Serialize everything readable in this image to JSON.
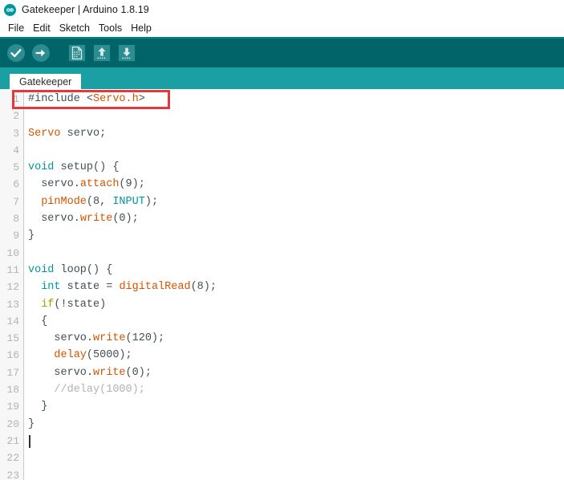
{
  "window": {
    "title": "Gatekeeper | Arduino 1.8.19",
    "logo_icon": "arduino-infinity-icon"
  },
  "menubar": {
    "items": [
      {
        "label": "File"
      },
      {
        "label": "Edit"
      },
      {
        "label": "Sketch"
      },
      {
        "label": "Tools"
      },
      {
        "label": "Help"
      }
    ]
  },
  "toolbar": {
    "background": "#006468",
    "buttons": [
      {
        "name": "verify-button",
        "icon": "check-circle-icon",
        "tooltip": "Verify"
      },
      {
        "name": "upload-button",
        "icon": "arrow-right-circle-icon",
        "tooltip": "Upload"
      },
      {
        "name": "new-button",
        "icon": "new-file-icon",
        "tooltip": "New"
      },
      {
        "name": "open-button",
        "icon": "arrow-up-open-icon",
        "tooltip": "Open"
      },
      {
        "name": "save-button",
        "icon": "arrow-down-save-icon",
        "tooltip": "Save"
      }
    ]
  },
  "tabbar": {
    "background": "#1a9fa2",
    "tabs": [
      {
        "label": "Gatekeeper",
        "active": true
      }
    ]
  },
  "editor": {
    "gutter_numbers": [
      "1",
      "2",
      "3",
      "4",
      "5",
      "6",
      "7",
      "8",
      "9",
      "10",
      "11",
      "12",
      "13",
      "14",
      "15",
      "16",
      "17",
      "18",
      "19",
      "20",
      "21",
      "22",
      "23"
    ],
    "cursor_line": 21,
    "lines": [
      {
        "n": 1,
        "tokens": [
          {
            "t": "#include ",
            "c": "plain"
          },
          {
            "t": "<",
            "c": "plain"
          },
          {
            "t": "Servo.h",
            "c": "type"
          },
          {
            "t": ">",
            "c": "plain"
          }
        ]
      },
      {
        "n": 2,
        "tokens": []
      },
      {
        "n": 3,
        "tokens": [
          {
            "t": "Servo",
            "c": "type"
          },
          {
            "t": " servo;",
            "c": "plain"
          }
        ]
      },
      {
        "n": 4,
        "tokens": []
      },
      {
        "n": 5,
        "tokens": [
          {
            "t": "void",
            "c": "kw"
          },
          {
            "t": " setup() {",
            "c": "plain"
          }
        ]
      },
      {
        "n": 6,
        "tokens": [
          {
            "t": "  servo.",
            "c": "plain"
          },
          {
            "t": "attach",
            "c": "fn"
          },
          {
            "t": "(9);",
            "c": "plain"
          }
        ]
      },
      {
        "n": 7,
        "tokens": [
          {
            "t": "  ",
            "c": "plain"
          },
          {
            "t": "pinMode",
            "c": "fn"
          },
          {
            "t": "(8, ",
            "c": "plain"
          },
          {
            "t": "INPUT",
            "c": "const"
          },
          {
            "t": ");",
            "c": "plain"
          }
        ]
      },
      {
        "n": 8,
        "tokens": [
          {
            "t": "  servo.",
            "c": "plain"
          },
          {
            "t": "write",
            "c": "fn"
          },
          {
            "t": "(0);",
            "c": "plain"
          }
        ]
      },
      {
        "n": 9,
        "tokens": [
          {
            "t": "}",
            "c": "plain"
          }
        ]
      },
      {
        "n": 10,
        "tokens": []
      },
      {
        "n": 11,
        "tokens": [
          {
            "t": "void",
            "c": "kw"
          },
          {
            "t": " loop() {",
            "c": "plain"
          }
        ]
      },
      {
        "n": 12,
        "tokens": [
          {
            "t": "  ",
            "c": "plain"
          },
          {
            "t": "int",
            "c": "kw"
          },
          {
            "t": " state = ",
            "c": "plain"
          },
          {
            "t": "digitalRead",
            "c": "fn"
          },
          {
            "t": "(8);",
            "c": "plain"
          }
        ]
      },
      {
        "n": 13,
        "tokens": [
          {
            "t": "  ",
            "c": "plain"
          },
          {
            "t": "if",
            "c": "ctrl"
          },
          {
            "t": "(!state)",
            "c": "plain"
          }
        ]
      },
      {
        "n": 14,
        "tokens": [
          {
            "t": "  {",
            "c": "plain"
          }
        ]
      },
      {
        "n": 15,
        "tokens": [
          {
            "t": "    servo.",
            "c": "plain"
          },
          {
            "t": "write",
            "c": "fn"
          },
          {
            "t": "(120);",
            "c": "plain"
          }
        ]
      },
      {
        "n": 16,
        "tokens": [
          {
            "t": "    ",
            "c": "plain"
          },
          {
            "t": "delay",
            "c": "fn"
          },
          {
            "t": "(5000);",
            "c": "plain"
          }
        ]
      },
      {
        "n": 17,
        "tokens": [
          {
            "t": "    servo.",
            "c": "plain"
          },
          {
            "t": "write",
            "c": "fn"
          },
          {
            "t": "(0);",
            "c": "plain"
          }
        ]
      },
      {
        "n": 18,
        "tokens": [
          {
            "t": "    //delay(1000);",
            "c": "comment"
          }
        ]
      },
      {
        "n": 19,
        "tokens": [
          {
            "t": "  }",
            "c": "plain"
          }
        ]
      },
      {
        "n": 20,
        "tokens": [
          {
            "t": "}",
            "c": "plain"
          }
        ]
      },
      {
        "n": 21,
        "tokens": []
      },
      {
        "n": 22,
        "tokens": []
      },
      {
        "n": 23,
        "tokens": []
      }
    ]
  },
  "annotation": {
    "color": "#e5383b",
    "target_line": 1,
    "label": "include-servo-highlight"
  }
}
